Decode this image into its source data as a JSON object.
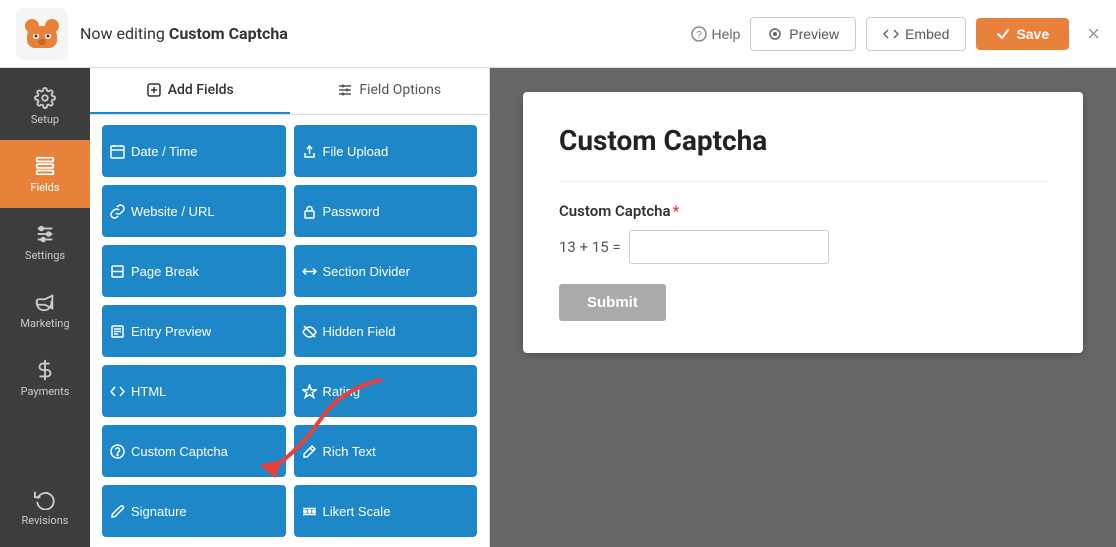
{
  "topbar": {
    "editing_prefix": "Now editing",
    "form_name": "Custom Captcha",
    "help_label": "Help",
    "preview_label": "Preview",
    "embed_label": "Embed",
    "save_label": "Save",
    "close_label": "×"
  },
  "sidebar": {
    "items": [
      {
        "id": "setup",
        "label": "Setup",
        "icon": "gear"
      },
      {
        "id": "fields",
        "label": "Fields",
        "icon": "fields",
        "active": true
      },
      {
        "id": "settings",
        "label": "Settings",
        "icon": "sliders"
      },
      {
        "id": "marketing",
        "label": "Marketing",
        "icon": "megaphone"
      },
      {
        "id": "payments",
        "label": "Payments",
        "icon": "dollar"
      },
      {
        "id": "revisions",
        "label": "Revisions",
        "icon": "refresh",
        "bottom": true
      }
    ]
  },
  "fields_panel": {
    "tabs": [
      {
        "id": "add-fields",
        "label": "Add Fields",
        "active": true
      },
      {
        "id": "field-options",
        "label": "Field Options",
        "active": false
      }
    ],
    "buttons": [
      {
        "id": "date-time",
        "label": "Date / Time",
        "icon": "calendar"
      },
      {
        "id": "file-upload",
        "label": "File Upload",
        "icon": "upload"
      },
      {
        "id": "website-url",
        "label": "Website / URL",
        "icon": "link"
      },
      {
        "id": "password",
        "label": "Password",
        "icon": "lock"
      },
      {
        "id": "page-break",
        "label": "Page Break",
        "icon": "page-break"
      },
      {
        "id": "section-divider",
        "label": "Section Divider",
        "icon": "divider"
      },
      {
        "id": "entry-preview",
        "label": "Entry Preview",
        "icon": "entry"
      },
      {
        "id": "hidden-field",
        "label": "Hidden Field",
        "icon": "hidden"
      },
      {
        "id": "html",
        "label": "HTML",
        "icon": "code"
      },
      {
        "id": "rating",
        "label": "Rating",
        "icon": "star"
      },
      {
        "id": "custom-captcha",
        "label": "Custom Captcha",
        "icon": "question"
      },
      {
        "id": "rich-text",
        "label": "Rich Text",
        "icon": "edit"
      },
      {
        "id": "signature",
        "label": "Signature",
        "icon": "pen"
      },
      {
        "id": "likert-scale",
        "label": "Likert Scale",
        "icon": "dots"
      }
    ]
  },
  "form_preview": {
    "title": "Custom Captcha",
    "field_label": "Custom Captcha",
    "required": true,
    "equation": "13 + 15 =",
    "input_placeholder": "",
    "submit_label": "Submit"
  }
}
